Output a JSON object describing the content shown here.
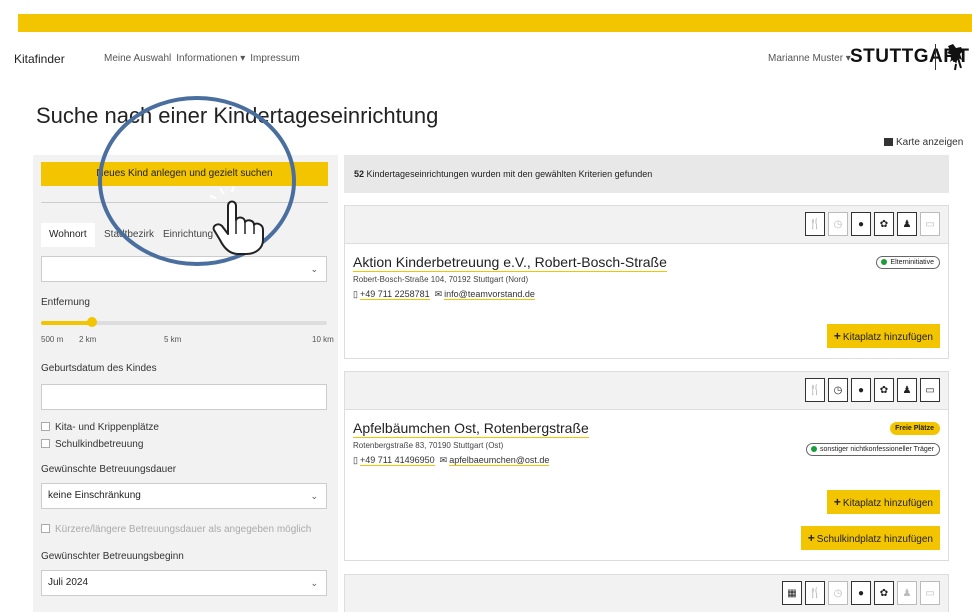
{
  "nav": {
    "brand": "Kitafinder",
    "links": [
      "Meine Auswahl",
      "Informationen ▾",
      "Impressum"
    ],
    "user": "Marianne Muster ▾",
    "logo": "STUTTGART"
  },
  "page": {
    "title": "Suche nach einer Kindertageseinrichtung",
    "map_link": "Karte anzeigen"
  },
  "sidebar": {
    "new_kid_button": "Neues Kind anlegen und gezielt suchen",
    "tabs": [
      "Wohnort",
      "Stadtbezirk",
      "Einrichtung"
    ],
    "distance_label": "Entfernung",
    "distance_ticks": [
      "500 m",
      "2 km",
      "5 km",
      "10 km"
    ],
    "distance_value_fraction": 0.18,
    "birthdate_label": "Geburtsdatum des Kindes",
    "check_kita": "Kita- und Krippenplätze",
    "check_school": "Schulkindbetreuung",
    "duration_label": "Gewünschte Betreuungsdauer",
    "duration_value": "keine Einschränkung",
    "flex_check": "Kürzere/längere Betreuungsdauer als angegeben möglich",
    "start_label": "Gewünschter Betreuungsbeginn",
    "start_value": "Juli 2024"
  },
  "results": {
    "count": "52",
    "summary": "Kindertageseinrichtungen wurden mit den gewählten Kriterien gefunden",
    "cards": [
      {
        "title": "Aktion Kinderbetreuung e.V., Robert-Bosch-Straße",
        "address": "Robert-Bosch-Straße 104, 70192 Stuttgart (Nord)",
        "phone": "+49 711 2258781",
        "email": "info@teamvorstand.de",
        "badge": "Elterninitiative",
        "add_kita": "Kitaplatz hinzufügen"
      },
      {
        "title": "Apfelbäumchen Ost, Rotenbergstraße",
        "address": "Rotenbergstraße 83, 70190 Stuttgart (Ost)",
        "phone": "+49 711 41496950",
        "email": "apfelbaeumchen@ost.de",
        "badge_free": "Freie Plätze",
        "badge": "sonstiger nichtkonfessioneller Träger",
        "add_kita": "Kitaplatz hinzufügen",
        "add_school": "Schulkindplatz hinzufügen"
      }
    ]
  }
}
